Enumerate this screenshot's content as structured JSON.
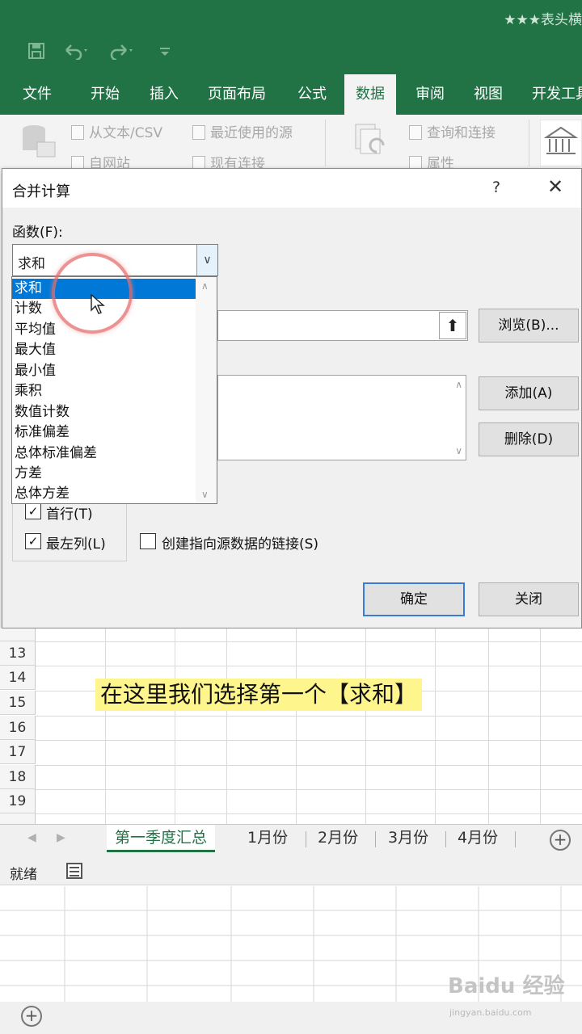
{
  "app": {
    "doc_title": "★★★表头横"
  },
  "ribbon_tabs": [
    {
      "label": "文件"
    },
    {
      "label": "开始"
    },
    {
      "label": "插入"
    },
    {
      "label": "页面布局"
    },
    {
      "label": "公式"
    },
    {
      "label": "数据",
      "active": true
    },
    {
      "label": "审阅"
    },
    {
      "label": "视图"
    },
    {
      "label": "开发工具"
    }
  ],
  "ribbon": {
    "from_text_csv": "从文本/CSV",
    "from_web": "自网站",
    "recent_sources": "最近使用的源",
    "existing_connections": "现有连接",
    "queries_connections": "查询和连接",
    "properties": "属性"
  },
  "dialog": {
    "title": "合并计算",
    "help": "?",
    "function_label": "函数(F):",
    "function_value": "求和",
    "browse_button": "浏览(B)...",
    "add_button": "添加(A)",
    "delete_button": "删除(D)",
    "first_row_label": "首行(T)",
    "left_column_label": "最左列(L)",
    "create_links_label": "创建指向源数据的链接(S)",
    "ok_button": "确定",
    "close_button": "关闭"
  },
  "function_options": [
    "求和",
    "计数",
    "平均值",
    "最大值",
    "最小值",
    "乘积",
    "数值计数",
    "标准偏差",
    "总体标准偏差",
    "方差",
    "总体方差"
  ],
  "sheet": {
    "row_numbers": [
      "13",
      "14",
      "15",
      "16",
      "17",
      "18",
      "19"
    ],
    "caption": "在这里我们选择第一个【求和】"
  },
  "sheet_tabs": [
    {
      "label": "第一季度汇总",
      "active": true
    },
    {
      "label": "1月份"
    },
    {
      "label": "2月份"
    },
    {
      "label": "3月份"
    },
    {
      "label": "4月份"
    }
  ],
  "status": {
    "ready": "就绪"
  },
  "watermark": {
    "main": "Baidu 经验",
    "sub": "jingyan.baidu.com"
  },
  "colors": {
    "excel_green": "#217346",
    "selection_blue": "#0078d7",
    "caption_highlight": "#fef68c"
  }
}
